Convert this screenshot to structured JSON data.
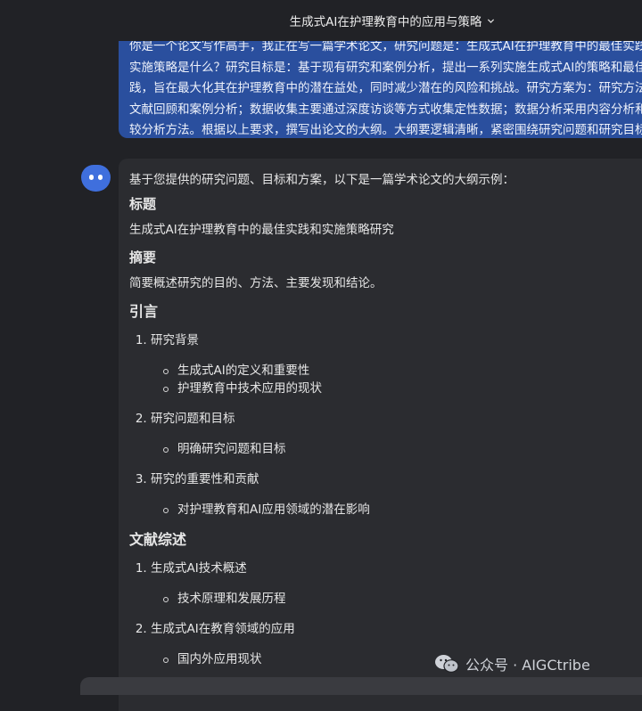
{
  "header": {
    "title": "生成式AI在护理教育中的应用与策略"
  },
  "user_message": {
    "lines": [
      "你是一个论文写作高手，我正在写一篇学术论文，研究问题是：生成式AI在护理教育中的最佳实践",
      "实施策略是什么？研究目标是：基于现有研究和案例分析，提出一系列实施生成式AI的策略和最佳",
      "践，旨在最大化其在护理教育中的潜在益处，同时减少潜在的风险和挑战。研究方案为：研究方法",
      "文献回顾和案例分析；数据收集主要通过深度访谈等方式收集定性数据；数据分析采用内容分析和",
      "较分析方法。根据以上要求，撰写出论文的大纲。大纲要逻辑清晰，紧密围绕研究问题和研究目标"
    ]
  },
  "answer": {
    "intro": "基于您提供的研究问题、目标和方案，以下是一篇学术论文的大纲示例：",
    "title_heading": "标题",
    "title_text": "生成式AI在护理教育中的最佳实践和实施策略研究",
    "abstract_heading": "摘要",
    "abstract_text": "简要概述研究的目的、方法、主要发现和结论。",
    "intro_heading": "引言",
    "intro_items": [
      {
        "label": "研究背景",
        "subs": [
          "生成式AI的定义和重要性",
          "护理教育中技术应用的现状"
        ]
      },
      {
        "label": "研究问题和目标",
        "subs": [
          "明确研究问题和目标"
        ]
      },
      {
        "label": "研究的重要性和贡献",
        "subs": [
          "对护理教育和AI应用领域的潜在影响"
        ]
      }
    ],
    "review_heading": "文献综述",
    "review_items": [
      {
        "label": "生成式AI技术概述",
        "subs": [
          "技术原理和发展历程"
        ]
      },
      {
        "label": "生成式AI在教育领域的应用",
        "subs": [
          "国内外应用现状"
        ]
      }
    ]
  },
  "watermark": {
    "text": "公众号 · AIGCtribe"
  },
  "colors": {
    "background": "#212226",
    "user_bubble": "#2a4f9e",
    "answer_bubble": "#2b2c30",
    "avatar": "#3f6fdd"
  }
}
